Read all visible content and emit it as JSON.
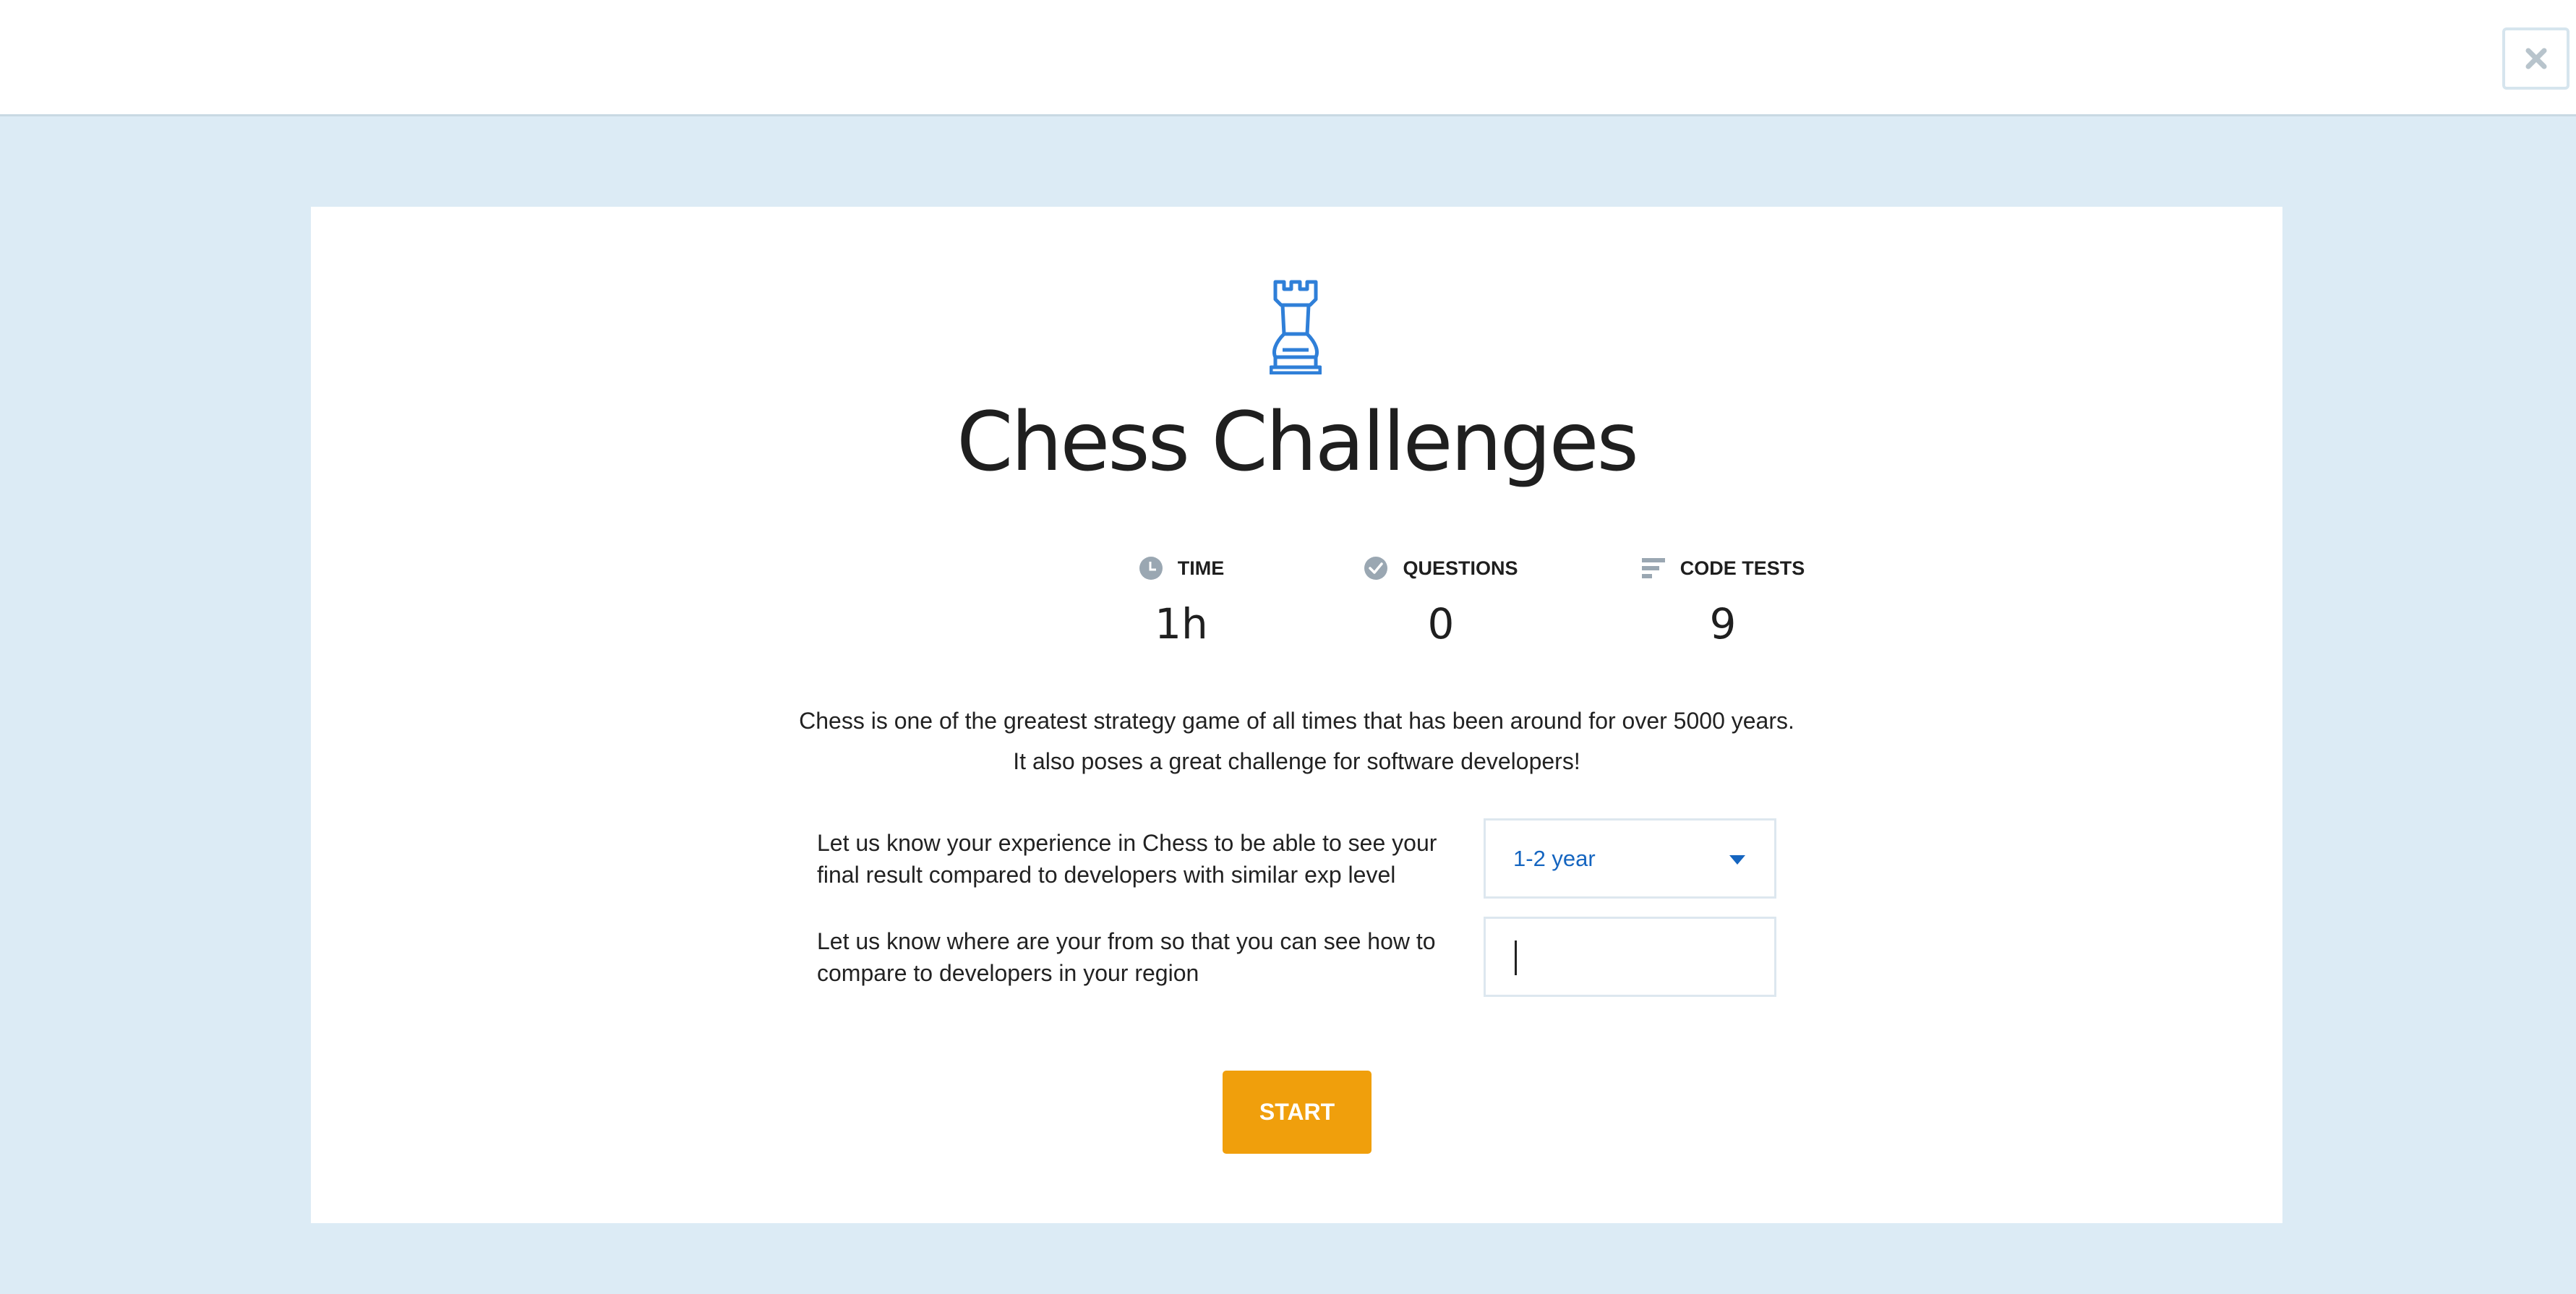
{
  "header": {
    "close_icon": "close-icon"
  },
  "challenge": {
    "icon": "chess-rook-icon",
    "title": "Chess Challenges",
    "stats": [
      {
        "icon": "clock-icon",
        "label": "TIME",
        "value": "1h"
      },
      {
        "icon": "check-circle-icon",
        "label": "QUESTIONS",
        "value": "0"
      },
      {
        "icon": "bars-icon",
        "label": "CODE TESTS",
        "value": "9"
      }
    ],
    "description_line1": "Chess is one of the greatest strategy game of all times that has been around for over 5000 years.",
    "description_line2": "It also poses a great challenge for software developers!"
  },
  "form": {
    "experience_label": "Let us know your experience in Chess to be able to see your final result compared to developers with similar exp level",
    "experience_value": "1-2 year",
    "region_label": "Let us know where are your from so that you can see how to compare to developers in your region",
    "region_value": ""
  },
  "actions": {
    "start_label": "START"
  },
  "colors": {
    "accent_blue": "#1565c0",
    "icon_blue": "#2f7fd8",
    "start_orange": "#f09f0c",
    "page_background": "#dcebf5"
  }
}
